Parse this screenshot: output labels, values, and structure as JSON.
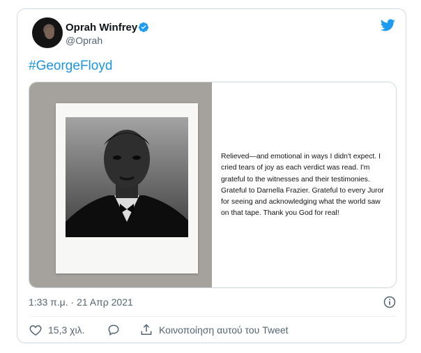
{
  "tweet": {
    "author_name": "Oprah Winfrey",
    "handle": "@Oprah",
    "hashtag": "#GeorgeFloyd",
    "image_text": "Relieved—and emotional in ways I didn't expect. I\ncried tears of joy as each verdict was read. I'm\ngrateful to the witnesses and their testimonies.\nGrateful to Darnella Frazier. Grateful to every Juror\nfor seeing and acknowledging what the world saw\non that tape. Thank you God for real!",
    "timestamp": "1:33 π.μ. · 21 Απρ 2021",
    "likes": "15,3 χιλ.",
    "share_label": "Κοινοποίηση αυτού του Tweet"
  },
  "icons": {
    "verified": "verified-badge-icon",
    "logo": "twitter-bird-icon",
    "info": "info-icon",
    "like": "heart-icon",
    "reply": "speech-bubble-icon",
    "share": "share-upload-icon"
  },
  "colors": {
    "accent": "#1d9bf0",
    "hashtag": "#1b95e0",
    "secondary_text": "#536471",
    "border": "#cfd9de"
  }
}
